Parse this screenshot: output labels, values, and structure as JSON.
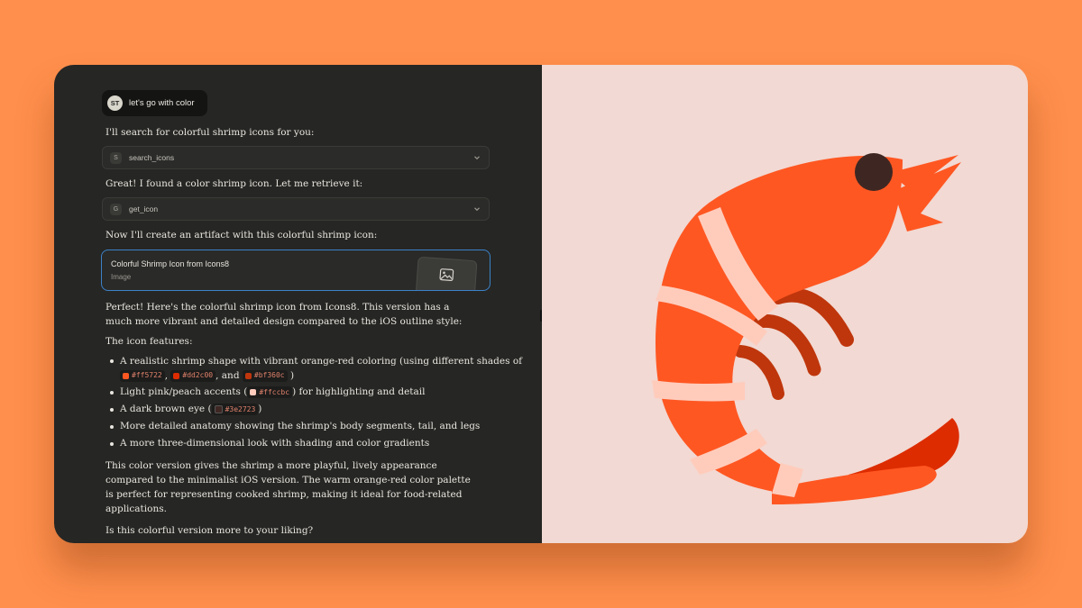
{
  "user": {
    "initials": "ST",
    "message": "let's go with color"
  },
  "messages": {
    "search_intro": "I'll search for colorful shrimp icons for you:",
    "found": "Great! I found a color shrimp icon. Let me retrieve it:",
    "create": "Now I'll create an artifact with this colorful shrimp icon:",
    "perfect": "Perfect! Here's the colorful shrimp icon from Icons8. This version has a much more vibrant and detailed design compared to the iOS outline style:",
    "features_intro": "The icon features:",
    "summary": "This color version gives the shrimp a more playful, lively appearance compared to the minimalist iOS version. The warm orange-red color palette is perfect for representing cooked shrimp, making it ideal for food-related applications.",
    "question": "Is this colorful version more to your liking?"
  },
  "tools": [
    {
      "badge": "S",
      "name": "search_icons"
    },
    {
      "badge": "G",
      "name": "get_icon"
    }
  ],
  "artifact": {
    "title": "Colorful Shrimp Icon from Icons8",
    "type": "Image"
  },
  "features": {
    "f1_text": "A realistic shrimp shape with vibrant orange-red coloring (using different shades of",
    "f1_sep1": ",",
    "f1_sep2": ", and",
    "f1_end": ")",
    "f2_pre": "Light pink/peach accents (",
    "f2_post": ") for highlighting and detail",
    "f3_pre": "A dark brown eye (",
    "f3_post": ")",
    "f4": "More detailed anatomy showing the shrimp's body segments, tail, and legs",
    "f5": "A more three-dimensional look with shading and color gradients"
  },
  "colors": {
    "c1": "#ff5722",
    "c2": "#dd2c00",
    "c3": "#bf360c",
    "c4": "#ffccbc",
    "c5": "#3e2723"
  },
  "icons": {
    "chevron": "chevron-down-icon",
    "image": "image-icon",
    "shrimp": "shrimp-icon"
  }
}
